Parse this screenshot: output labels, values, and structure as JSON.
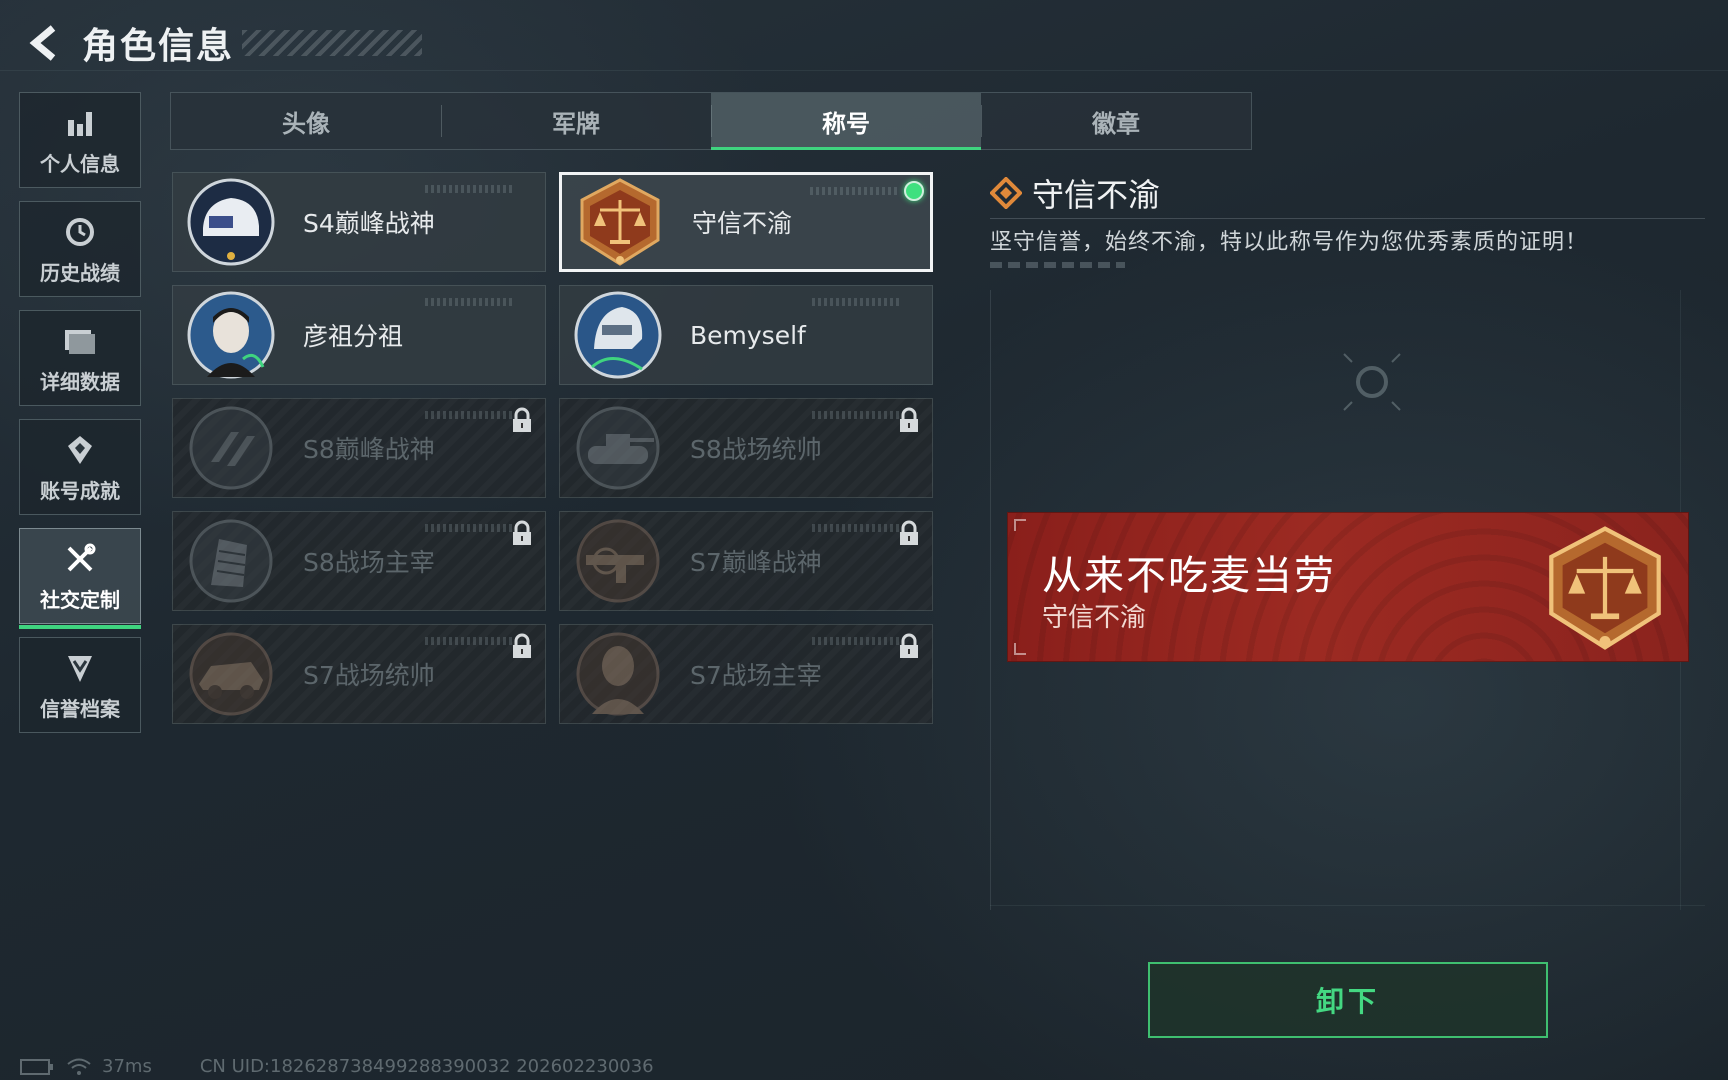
{
  "header": {
    "title": "角色信息"
  },
  "sidebar": {
    "items": [
      {
        "label": "个人信息",
        "icon": "bar-chart-icon",
        "active": false
      },
      {
        "label": "历史战绩",
        "icon": "history-icon",
        "active": false
      },
      {
        "label": "详细数据",
        "icon": "folder-icon",
        "active": false
      },
      {
        "label": "账号成就",
        "icon": "medal-icon",
        "active": false
      },
      {
        "label": "社交定制",
        "icon": "tools-icon",
        "active": true
      },
      {
        "label": "信誉档案",
        "icon": "shield-icon",
        "active": false
      }
    ]
  },
  "tabs": [
    {
      "label": "头像",
      "active": false
    },
    {
      "label": "军牌",
      "active": false
    },
    {
      "label": "称号",
      "active": true
    },
    {
      "label": "徽章",
      "active": false
    }
  ],
  "titles": [
    {
      "label": "S4巅峰战神",
      "locked": false,
      "selected": false,
      "badge": "helmet-badge-icon"
    },
    {
      "label": "守信不渝",
      "locked": false,
      "selected": true,
      "badge": "scales-badge-icon"
    },
    {
      "label": "彦祖分祖",
      "locked": false,
      "selected": false,
      "badge": "portrait-badge-icon"
    },
    {
      "label": "Bemyself",
      "locked": false,
      "selected": false,
      "badge": "soldier-badge-icon"
    },
    {
      "label": "S8巅峰战神",
      "locked": true,
      "selected": false,
      "badge": "stripes-badge-icon"
    },
    {
      "label": "S8战场统帅",
      "locked": true,
      "selected": false,
      "badge": "tank-badge-icon"
    },
    {
      "label": "S8战场主宰",
      "locked": true,
      "selected": false,
      "badge": "building-badge-icon"
    },
    {
      "label": "S7巅峰战神",
      "locked": true,
      "selected": false,
      "badge": "gun-badge-icon"
    },
    {
      "label": "S7战场统帅",
      "locked": true,
      "selected": false,
      "badge": "vehicle-badge-icon"
    },
    {
      "label": "S7战场主宰",
      "locked": true,
      "selected": false,
      "badge": "warrior-badge-icon"
    }
  ],
  "detail": {
    "name": "守信不渝",
    "description": "坚守信誉，始终不渝，特以此称号作为您优秀素质的证明！"
  },
  "banner": {
    "player_name": "从来不吃麦当劳",
    "title": "守信不渝"
  },
  "actions": {
    "unequip_label": "卸下"
  },
  "footer": {
    "ping": "37ms",
    "uid": "CN UID:1826287384992883900​32 202602230036"
  },
  "colors": {
    "accent_green": "#3fd47f",
    "banner_red": "#9c2a22",
    "medal_bronze": "#b5692e"
  }
}
